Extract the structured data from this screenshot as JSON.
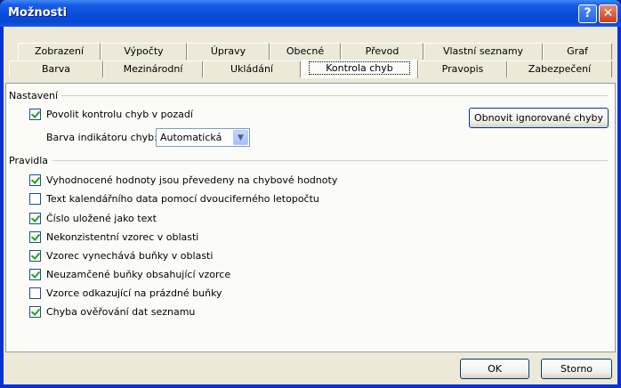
{
  "window": {
    "title": "Možnosti",
    "help_glyph": "?",
    "close_glyph": "✕"
  },
  "tabs_row1": [
    {
      "label": "Zobrazení"
    },
    {
      "label": "Výpočty"
    },
    {
      "label": "Úpravy"
    },
    {
      "label": "Obecné"
    },
    {
      "label": "Převod"
    },
    {
      "label": "Vlastní seznamy"
    },
    {
      "label": "Graf"
    }
  ],
  "tabs_row2": [
    {
      "label": "Barva"
    },
    {
      "label": "Mezinárodní"
    },
    {
      "label": "Ukládání"
    },
    {
      "label": "Kontrola chyb",
      "active": true
    },
    {
      "label": "Pravopis"
    },
    {
      "label": "Zabezpečení"
    }
  ],
  "settings": {
    "group_title": "Nastavení",
    "background_check_label": "Povolit kontrolu chyb v pozadí",
    "background_check_checked": true,
    "indicator_label": "Barva indikátoru chyb:",
    "indicator_value": "Automatická",
    "reset_button": "Obnovit ignorované chyby"
  },
  "rules": {
    "group_title": "Pravidla",
    "items": [
      {
        "label": "Vyhodnocené hodnoty jsou převedeny na chybové hodnoty",
        "checked": true
      },
      {
        "label": "Text kalendářního data pomocí dvouciferného letopočtu",
        "checked": false
      },
      {
        "label": "Číslo uložené jako text",
        "checked": true
      },
      {
        "label": "Nekonzistentní vzorec v oblasti",
        "checked": true
      },
      {
        "label": "Vzorec vynechává buňky v oblasti",
        "checked": true
      },
      {
        "label": "Neuzamčené buňky obsahující vzorce",
        "checked": true
      },
      {
        "label": "Vzorce odkazující na prázdné buňky",
        "checked": false
      },
      {
        "label": "Chyba ověřování dat seznamu",
        "checked": true
      }
    ]
  },
  "footer": {
    "ok_label": "OK",
    "cancel_label": "Storno"
  },
  "colors": {
    "titlebar": "#0a4fdc",
    "dialog_bg": "#ece9d8",
    "panel_bg": "#fbfbf8",
    "check_mark": "#21a121"
  }
}
